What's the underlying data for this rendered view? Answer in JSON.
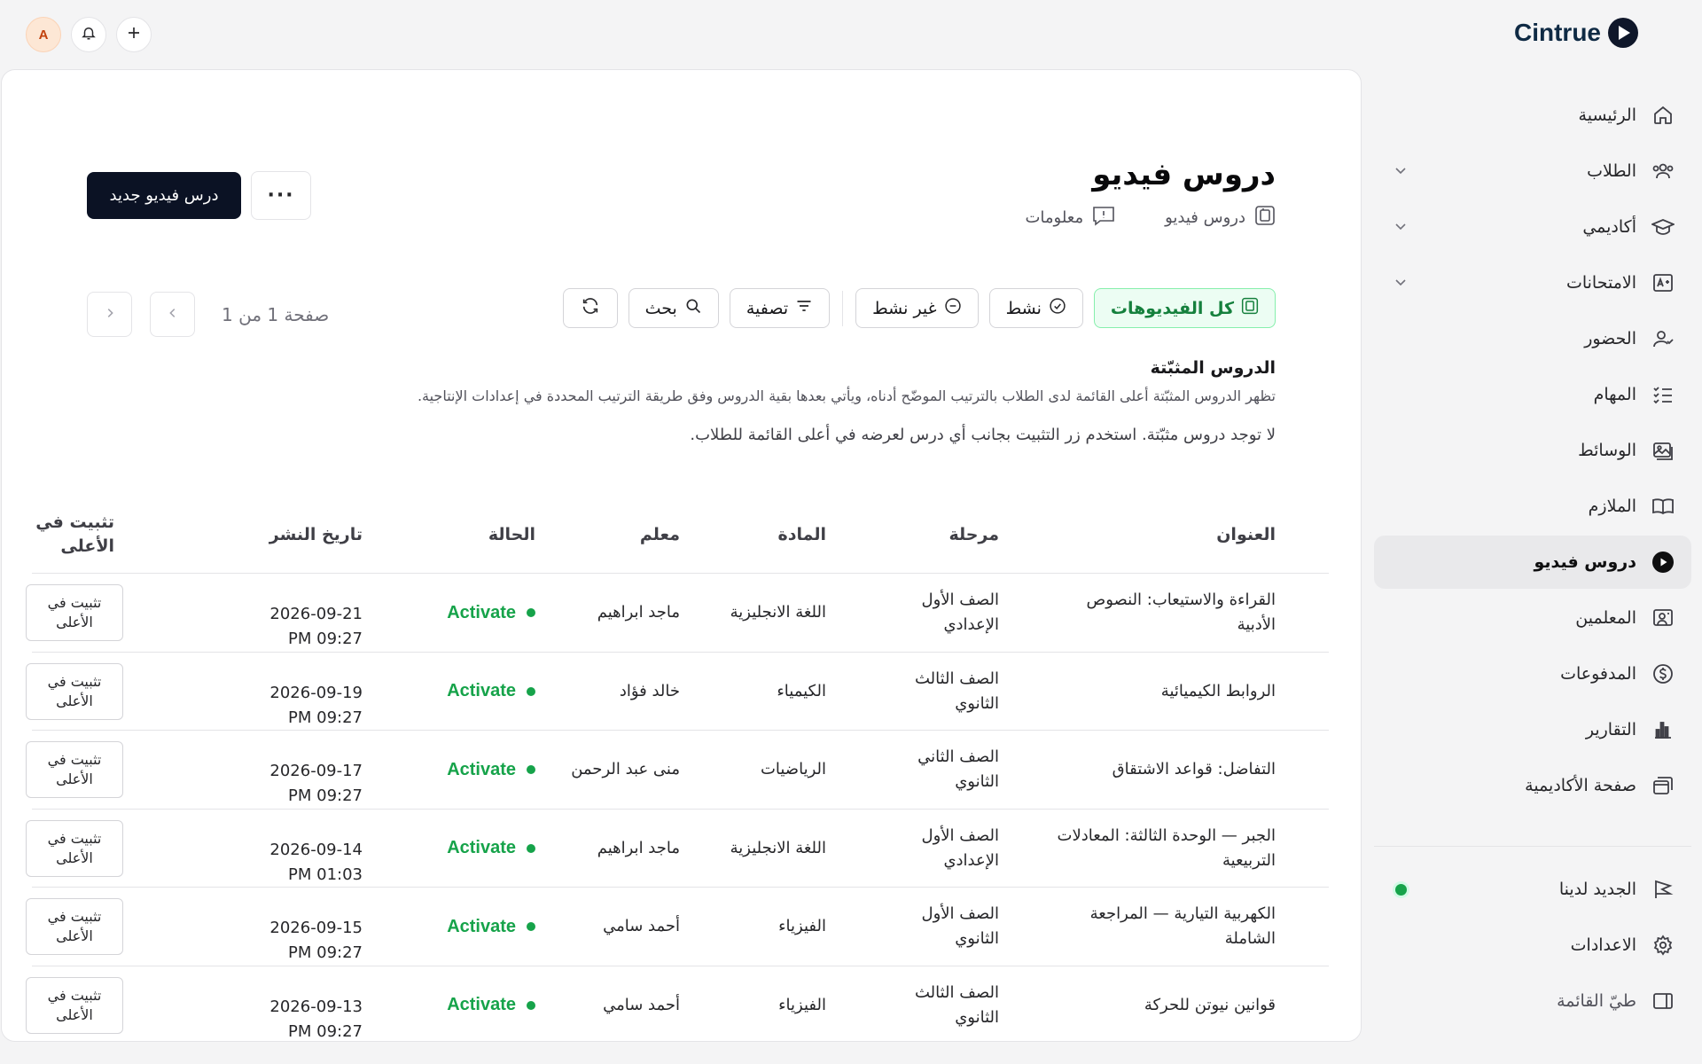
{
  "app": {
    "name": "Cintrue"
  },
  "topbar": {
    "avatar_initial": "A"
  },
  "sidebar": {
    "items": [
      {
        "label": "الرئيسية",
        "icon": "home-icon",
        "has_chevron": false
      },
      {
        "label": "الطلاب",
        "icon": "users-icon",
        "has_chevron": true
      },
      {
        "label": "أكاديمي",
        "icon": "graduation-cap-icon",
        "has_chevron": true
      },
      {
        "label": "الامتحانات",
        "icon": "grade-icon",
        "has_chevron": true
      },
      {
        "label": "الحضور",
        "icon": "user-check-icon",
        "has_chevron": false
      },
      {
        "label": "المهام",
        "icon": "list-checks-icon",
        "has_chevron": false
      },
      {
        "label": "الوسائط",
        "icon": "image-icon",
        "has_chevron": false
      },
      {
        "label": "الملازم",
        "icon": "book-open-icon",
        "has_chevron": false
      },
      {
        "label": "دروس فيديو",
        "icon": "play-circle-icon",
        "has_chevron": false,
        "active": true
      },
      {
        "label": "المعلمين",
        "icon": "teacher-board-icon",
        "has_chevron": false
      },
      {
        "label": "المدفوعات",
        "icon": "dollar-circle-icon",
        "has_chevron": false
      },
      {
        "label": "التقارير",
        "icon": "bar-chart-icon",
        "has_chevron": false
      },
      {
        "label": "صفحة الأكاديمية",
        "icon": "window-stack-icon",
        "has_chevron": false
      }
    ],
    "bottom_items": [
      {
        "label": "الجديد لدينا",
        "icon": "flag-icon",
        "has_dot": true
      },
      {
        "label": "الاعدادات",
        "icon": "gear-icon"
      },
      {
        "label": "طيّ القائمة",
        "icon": "sidebar-collapse-icon"
      }
    ]
  },
  "page": {
    "title": "دروس فيديو",
    "breadcrumb": "دروس فيديو",
    "info_label": "معلومات",
    "new_button": "درس فيديو جديد",
    "more_label": "···"
  },
  "filters": {
    "all": "كل الفيديوهات",
    "active": "نشط",
    "inactive": "غير نشط",
    "filter": "تصفية",
    "search": "بحث"
  },
  "pagination": {
    "text": "صفحة 1 من 1"
  },
  "pinned": {
    "title": "الدروس المثبّتة",
    "description": "تظهر الدروس المثبّتة أعلى القائمة لدى الطلاب بالترتيب الموضّح أدناه، ويأتي بعدها بقية الدروس وفق طريقة الترتيب المحددة في إعدادات الإنتاجية.",
    "empty": "لا توجد دروس مثبّتة. استخدم زر التثبيت بجانب أي درس لعرضه في أعلى القائمة للطلاب."
  },
  "table": {
    "headers": {
      "title": "العنوان",
      "stage": "مرحلة",
      "subject": "المادة",
      "teacher": "معلم",
      "status": "الحالة",
      "date": "تاريخ النشر",
      "pin": "تثبيت في الأعلى"
    },
    "rows": [
      {
        "title": "القراءة والاستيعاب: النصوص الأدبية",
        "stage": "الصف الأول الإعدادي",
        "subject": "اللغة الانجليزية",
        "teacher": "ماجد ابراهيم",
        "status": "Activate",
        "date": "2026-09-21",
        "time": "PM 09:27",
        "pin": "تثبيت في الأعلى"
      },
      {
        "title": "الروابط الكيميائية",
        "stage": "الصف الثالث الثانوي",
        "subject": "الكيمياء",
        "teacher": "خالد فؤاد",
        "status": "Activate",
        "date": "2026-09-19",
        "time": "PM 09:27",
        "pin": "تثبيت في الأعلى"
      },
      {
        "title": "التفاضل: قواعد الاشتقاق",
        "stage": "الصف الثاني الثانوي",
        "subject": "الرياضيات",
        "teacher": "منى عبد الرحمن",
        "status": "Activate",
        "date": "2026-09-17",
        "time": "PM 09:27",
        "pin": "تثبيت في الأعلى"
      },
      {
        "title": "الجبر — الوحدة الثالثة: المعادلات التربيعية",
        "stage": "الصف الأول الإعدادي",
        "subject": "اللغة الانجليزية",
        "teacher": "ماجد ابراهيم",
        "status": "Activate",
        "date": "2026-09-14",
        "time": "PM 01:03",
        "pin": "تثبيت في الأعلى"
      },
      {
        "title": "الكهربية التيارية — المراجعة الشاملة",
        "stage": "الصف الأول الثانوي",
        "subject": "الفيزياء",
        "teacher": "أحمد سامي",
        "status": "Activate",
        "date": "2026-09-15",
        "time": "PM 09:27",
        "pin": "تثبيت في الأعلى"
      },
      {
        "title": "قوانين نيوتن للحركة",
        "stage": "الصف الثالث الثانوي",
        "subject": "الفيزياء",
        "teacher": "أحمد سامي",
        "status": "Activate",
        "date": "2026-09-13",
        "time": "PM 09:27",
        "pin": "تثبيت في الأعلى"
      }
    ]
  },
  "colors": {
    "brand": "#0f2a44",
    "primary_button": "#0b1224",
    "active_green": "#16a34a",
    "selected_chip_bg": "#ecfdf3"
  }
}
